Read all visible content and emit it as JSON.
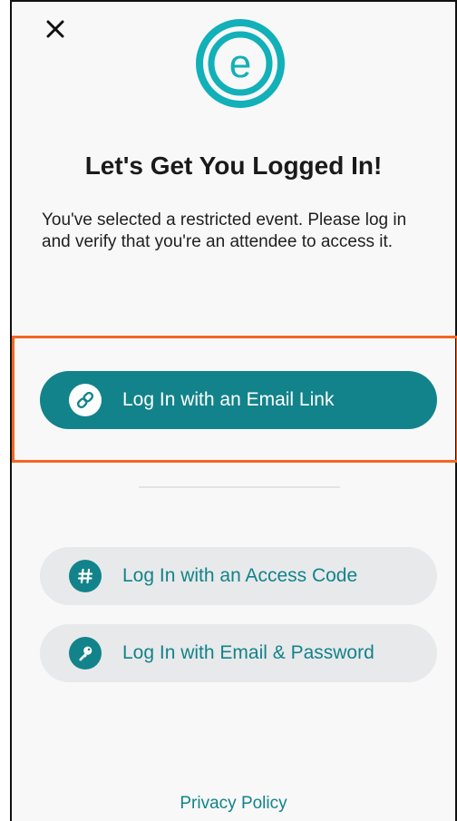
{
  "colors": {
    "accent": "#12838a",
    "highlight_border": "#f26722",
    "background": "#f8f8f8",
    "secondary_button_bg": "#e8e9eb"
  },
  "header": {
    "close_icon": "close-icon"
  },
  "logo": {
    "letter": "e",
    "icon": "brand-logo"
  },
  "heading": "Let's Get You Logged In!",
  "description": "You've selected a restricted event. Please log in and verify that you're an attendee to access it.",
  "buttons": {
    "email_link": {
      "label": "Log In with an Email Link",
      "icon": "link-icon"
    },
    "access_code": {
      "label": "Log In with an Access Code",
      "icon": "hash-icon"
    },
    "email_password": {
      "label": "Log In with Email & Password",
      "icon": "key-icon"
    }
  },
  "footer": {
    "privacy_label": "Privacy Policy"
  }
}
